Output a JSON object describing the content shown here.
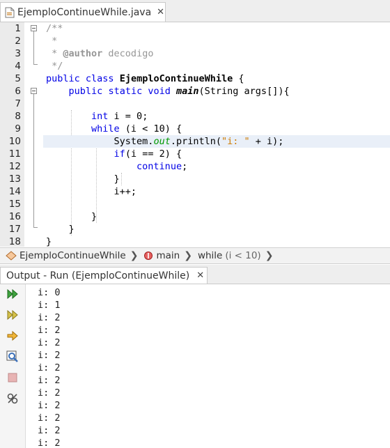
{
  "editor_tab": {
    "title": "EjemploContinueWhile.java",
    "close": "✕"
  },
  "code_lines": [
    {
      "n": "1",
      "html": "<span class=\"cm\">/**</span>"
    },
    {
      "n": "2",
      "html": "<span class=\"cm\"> *</span>"
    },
    {
      "n": "3",
      "html": "<span class=\"cm\"> * </span><span class=\"cmb\">@author</span><span class=\"cm\"> decodigo</span>"
    },
    {
      "n": "4",
      "html": "<span class=\"cm\"> */</span>"
    },
    {
      "n": "5",
      "html": "<span class=\"kw\">public</span> <span class=\"kw\">class</span> <span class=\"cls\">EjemploContinueWhile</span> {"
    },
    {
      "n": "6",
      "html": "    <span class=\"kw\">public</span> <span class=\"kw\">static</span> <span class=\"kw\">void</span> <span class=\"fn\">main</span>(String args[]){"
    },
    {
      "n": "7",
      "html": ""
    },
    {
      "n": "8",
      "html": "        <span class=\"kw\">int</span> i = 0;"
    },
    {
      "n": "9",
      "html": "        <span class=\"kw\">while</span> (i &lt; 10) {"
    },
    {
      "n": "10",
      "html": "            System.<span class=\"fld\">out</span>.println(<span class=\"st\">\"i: \"</span> + i);"
    },
    {
      "n": "11",
      "html": "            <span class=\"kw\">if</span>(i == 2) {"
    },
    {
      "n": "12",
      "html": "                <span class=\"kw\">continue</span>;"
    },
    {
      "n": "13",
      "html": "            }"
    },
    {
      "n": "14",
      "html": "            i++;"
    },
    {
      "n": "15",
      "html": ""
    },
    {
      "n": "16",
      "html": "        }"
    },
    {
      "n": "17",
      "html": "    }"
    },
    {
      "n": "18",
      "html": "}"
    }
  ],
  "breadcrumb": {
    "class_name": "EjemploContinueWhile",
    "method": "main",
    "loop_keyword": "while",
    "loop_cond": "(i < 10)"
  },
  "output_tab": {
    "title": "Output - Run (EjemploContinueWhile)",
    "close": "✕"
  },
  "output_lines": [
    "i: 0",
    "i: 1",
    "i: 2",
    "i: 2",
    "i: 2",
    "i: 2",
    "i: 2",
    "i: 2",
    "i: 2",
    "i: 2",
    "i: 2",
    "i: 2",
    "i: 2"
  ],
  "toolbar": [
    "rerun-icon",
    "rerun-customized-icon",
    "step-over-icon",
    "inspect-icon",
    "stop-icon",
    "settings-icon"
  ],
  "colors": {
    "keyword": "#0000e6",
    "comment": "#969696",
    "string": "#ce7b00",
    "field": "#009900",
    "highlight": "#e9eff8"
  }
}
